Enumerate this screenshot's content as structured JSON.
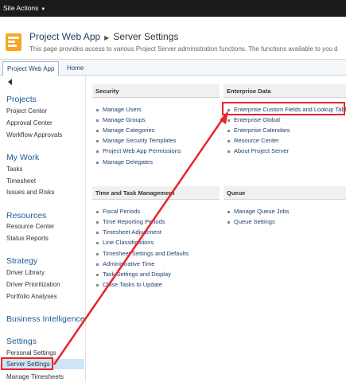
{
  "site_actions": {
    "label": "Site Actions"
  },
  "header": {
    "app_name": "Project Web App",
    "page_title": "Server Settings",
    "description": "This page provides access to various Project Server administration functions. The functions available to you d"
  },
  "tabs": [
    {
      "label": "Project Web App"
    },
    {
      "label": "Home"
    }
  ],
  "nav": {
    "projects": {
      "heading": "Projects",
      "items": [
        "Project Center",
        "Approval Center",
        "Workflow Approvals"
      ]
    },
    "my_work": {
      "heading": "My Work",
      "items": [
        "Tasks",
        "Timesheet",
        "Issues and Risks"
      ]
    },
    "resources": {
      "heading": "Resources",
      "items": [
        "Resource Center",
        "Status Reports"
      ]
    },
    "strategy": {
      "heading": "Strategy",
      "items": [
        "Driver Library",
        "Driver Prioritization",
        "Portfolio Analyses"
      ]
    },
    "business_intelligence": {
      "heading": "Business Intelligence"
    },
    "settings": {
      "heading": "Settings",
      "items": [
        "Personal Settings",
        "Server Settings",
        "Manage Timesheets"
      ]
    }
  },
  "sections": {
    "security": {
      "title": "Security",
      "links": [
        "Manage Users",
        "Manage Groups",
        "Manage Categories",
        "Manage Security Templates",
        "Project Web App Permissions",
        "Manage Delegates"
      ]
    },
    "enterprise_data": {
      "title": "Enterprise Data",
      "links": [
        "Enterprise Custom Fields and Lookup Tables",
        "Enterprise Global",
        "Enterprise Calendars",
        "Resource Center",
        "About Project Server"
      ]
    },
    "time_task": {
      "title": "Time and Task Management",
      "links": [
        "Fiscal Periods",
        "Time Reporting Periods",
        "Timesheet Adjustment",
        "Line Classifications",
        "Timesheet Settings and Defaults",
        "Administrative Time",
        "Task Settings and Display",
        "Close Tasks to Update"
      ]
    },
    "queue": {
      "title": "Queue",
      "links": [
        "Manage Queue Jobs",
        "Queue Settings"
      ]
    }
  },
  "colors": {
    "highlight": "#e8242b",
    "link": "#1f3f6b",
    "heading": "#1f5a96",
    "selected_bg": "#cde6f7"
  }
}
